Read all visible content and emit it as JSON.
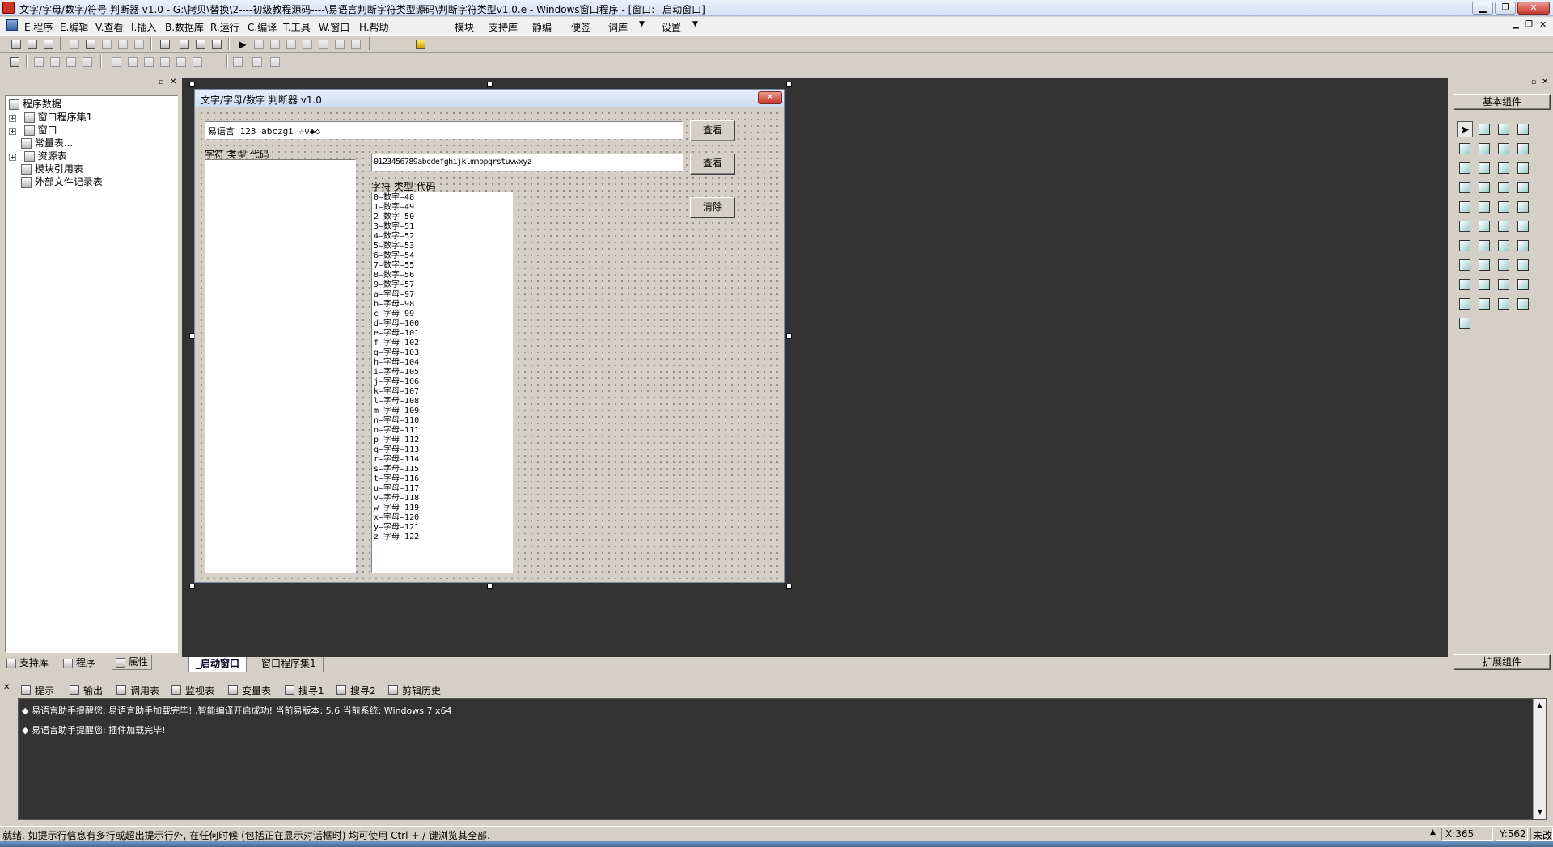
{
  "window": {
    "title": "文字/字母/数字/符号 判断器 v1.0 - G:\\拷贝\\替换\\2----初级教程源码----\\易语言判断字符类型源码\\判断字符类型v1.0.e - Windows窗口程序 - [窗口: _启动窗口]"
  },
  "menu": {
    "left": [
      "E.程序",
      "E.编辑",
      "V.查看",
      "I.插入",
      "B.数据库",
      "R.运行",
      "C.编译",
      "T.工具",
      "W.窗口",
      "H.帮助"
    ],
    "right": [
      "模块",
      "支持库",
      "静编",
      "便签",
      "词库",
      "设置"
    ]
  },
  "left_panel": {
    "tree": [
      {
        "label": "程序数据",
        "level": 0,
        "expander": false
      },
      {
        "label": "窗口程序集1",
        "level": 1,
        "expander": true
      },
      {
        "label": "窗口",
        "level": 1,
        "expander": true
      },
      {
        "label": "常量表...",
        "level": 1,
        "expander": false
      },
      {
        "label": "资源表",
        "level": 1,
        "expander": true
      },
      {
        "label": "模块引用表",
        "level": 1,
        "expander": false
      },
      {
        "label": "外部文件记录表",
        "level": 1,
        "expander": false
      }
    ],
    "tabs": [
      "支持库",
      "程序",
      "属性"
    ]
  },
  "designer": {
    "form_title": "文字/字母/数字 判断器 v1.0",
    "input1_value": "易语言 123 abczgi ☆♀◆◇",
    "input2_value": "0123456789abcdefghijklmnopqrstuvwxyz",
    "view_button1": "查看",
    "view_button2": "查看",
    "clear_button": "清除",
    "list1_header": "字符 类型 代码",
    "list2_header": "字符 类型 代码",
    "list2_items": [
      "0—数字—48",
      "1—数字—49",
      "2—数字—50",
      "3—数字—51",
      "4—数字—52",
      "5—数字—53",
      "6—数字—54",
      "7—数字—55",
      "8—数字—56",
      "9—数字—57",
      "a—字母—97",
      "b—字母—98",
      "c—字母—99",
      "d—字母—100",
      "e—字母—101",
      "f—字母—102",
      "g—字母—103",
      "h—字母—104",
      "i—字母—105",
      "j—字母—106",
      "k—字母—107",
      "l—字母—108",
      "m—字母—109",
      "n—字母—110",
      "o—字母—111",
      "p—字母—112",
      "q—字母—113",
      "r—字母—114",
      "s—字母—115",
      "t—字母—116",
      "u—字母—117",
      "v—字母—118",
      "w—字母—119",
      "x—字母—120",
      "y—字母—121",
      "z—字母—122"
    ],
    "doc_tabs": [
      "_启动窗口",
      "窗口程序集1"
    ]
  },
  "right_panel": {
    "header": "基本组件",
    "footer": "扩展组件"
  },
  "output": {
    "tabs": [
      "提示",
      "输出",
      "调用表",
      "监视表",
      "变量表",
      "搜寻1",
      "搜寻2",
      "剪辑历史"
    ],
    "messages": [
      "易语言助手提醒您: 易语言助手加载完毕! ,智能编译开启成功! 当前易版本: 5.6 当前系统: Windows 7 x64",
      "易语言助手提醒您: 插件加载完毕!"
    ]
  },
  "status": {
    "text": "就绪. 如提示行信息有多行或超出提示行外, 在任何时候 (包括正在显示对话框时) 均可使用 Ctrl + / 键浏览其全部.",
    "x": "X:365",
    "y": "Y:562",
    "extra": "未改"
  },
  "colors": {
    "titlebar": "#d8e4f8",
    "workspace": "#333333",
    "face": "#d4d0c8",
    "close": "#c8352a"
  }
}
